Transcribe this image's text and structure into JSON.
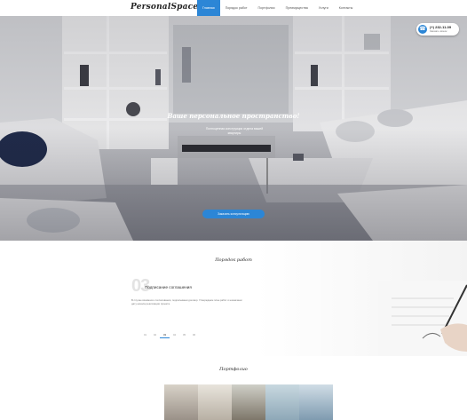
{
  "header": {
    "logo": "PersonalSpace",
    "nav": [
      "Главная",
      "Порядок работ",
      "Портфолио",
      "Преимущества",
      "Услуги",
      "Контакты"
    ],
    "active_index": 0
  },
  "phone": {
    "number": "(+) 232-11-09",
    "caption": "Заказать звонок"
  },
  "hero": {
    "title": "Ваше персональное пространство!",
    "subtitle": "Полноценная конструкция отдела вашей квартиры",
    "button": "Заказать консультацию"
  },
  "work": {
    "title": "Порядок работ",
    "step_number": "03",
    "step_title": "Подписание соглашения",
    "step_text": "В случае взаимного согласования, подписываем договор. Утверждаем план работ и назначаем дату начала реализации проекта.",
    "pages": [
      "01",
      "02",
      "03",
      "04",
      "05",
      "06"
    ],
    "active_page": 2
  },
  "portfolio": {
    "title": "Портфолио"
  },
  "colors": {
    "accent": "#2c86d6"
  }
}
